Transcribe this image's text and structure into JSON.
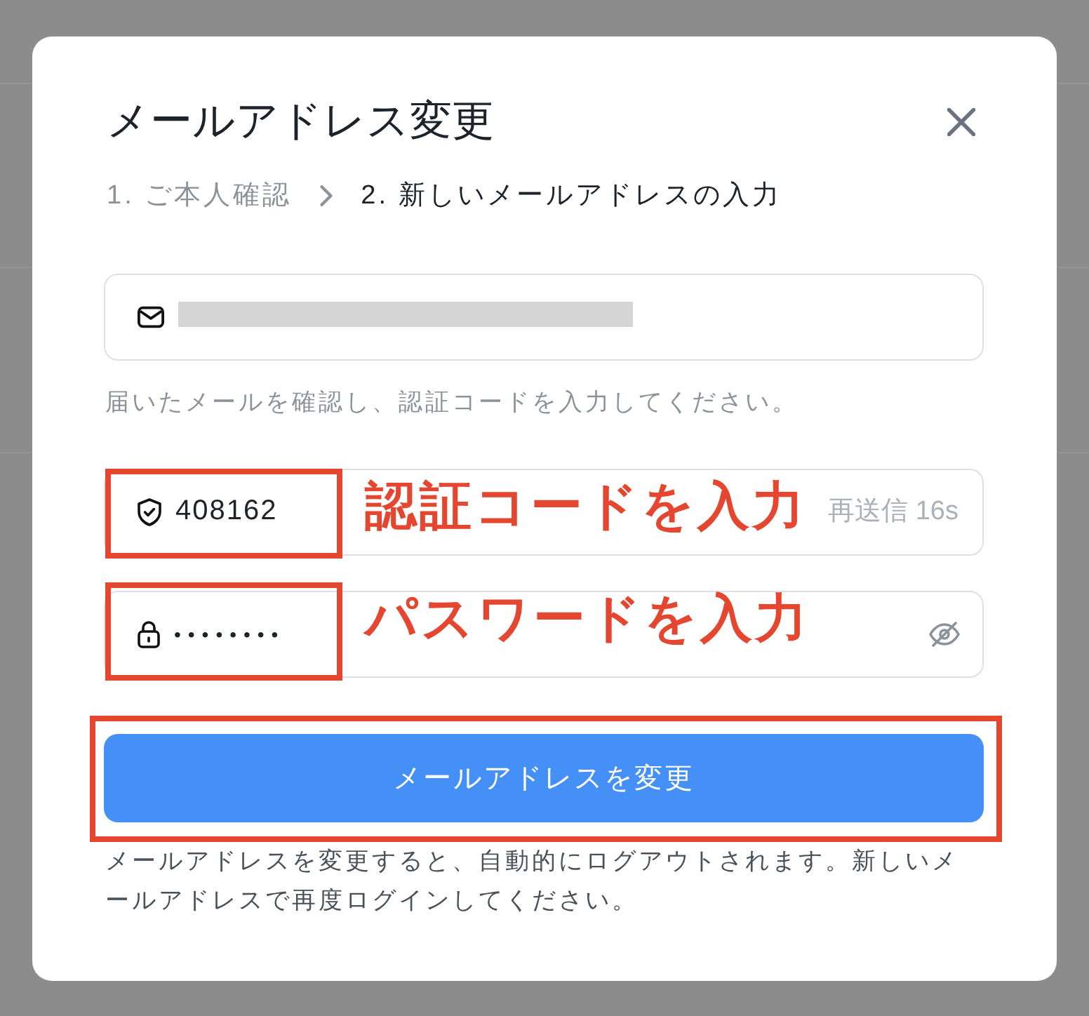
{
  "dialog": {
    "title": "メールアドレス変更"
  },
  "steps": [
    {
      "label": "1. ご本人確認",
      "selected": false
    },
    {
      "label": "2. 新しいメールアドレスの入力",
      "selected": true
    }
  ],
  "email_field": {
    "redacted": true
  },
  "hint": "届いたメールを確認し、認証コードを入力してください。",
  "code_field": {
    "value": "408162",
    "resend": {
      "label": "再送信 16s",
      "disabled": true
    },
    "highlighted": true,
    "annotation": "認証コードを入力"
  },
  "password_field": {
    "value": "••••••••",
    "revealed": false,
    "highlighted": true,
    "annotation": "パスワードを入力"
  },
  "submit_button": {
    "label": "メールアドレスを変更",
    "highlighted": true
  },
  "notice": "メールアドレスを変更すると、自動的にログアウトされます。新しいメールアドレスで再度ログインしてください。"
}
